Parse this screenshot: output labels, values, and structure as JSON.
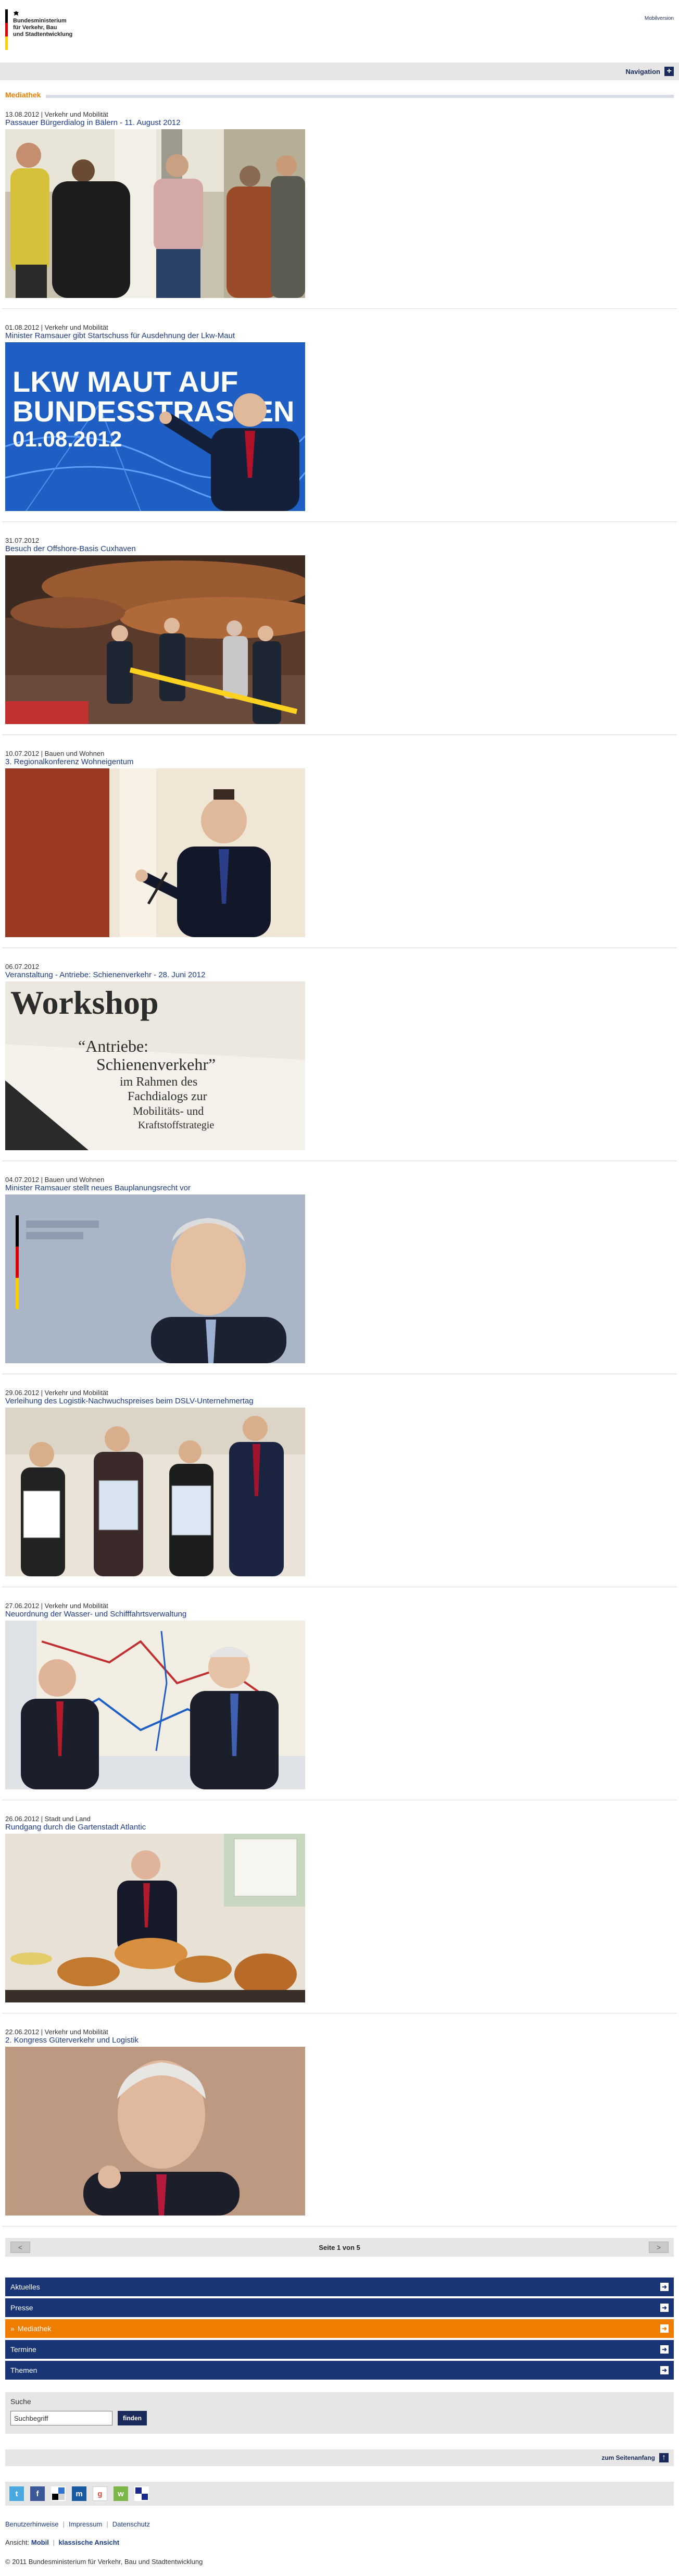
{
  "header": {
    "logo_lines": [
      "Bundesministerium",
      "für Verkehr, Bau",
      "und Stadtentwicklung"
    ],
    "mobile_version": "Mobilversion"
  },
  "navbar": {
    "label": "Navigation"
  },
  "section": {
    "title": "Mediathek"
  },
  "items": [
    {
      "meta": "13.08.2012 | Verkehr und Mobilität",
      "title": "Passauer Bürgerdialog in Bälern - 11. August 2012"
    },
    {
      "meta": "01.08.2012 | Verkehr und Mobilität",
      "title": "Minister Ramsauer gibt Startschuss für Ausdehnung der Lkw-Maut",
      "overlay1": "LKW MAUT AUF",
      "overlay2": "BUNDESSTRASSEN",
      "overlay3": "01.08.2012"
    },
    {
      "meta": "31.07.2012",
      "title": "Besuch der Offshore-Basis Cuxhaven"
    },
    {
      "meta": "10.07.2012 | Bauen und Wohnen",
      "title": "3. Regionalkonferenz Wohneigentum"
    },
    {
      "meta": "06.07.2012",
      "title": "Veranstaltung - Antriebe: Schienenverkehr - 28. Juni 2012",
      "overlay1": "Workshop",
      "overlay2": "“Antriebe:",
      "overlay3": "Schienenverkehr”",
      "overlay4": "im Rahmen des",
      "overlay5": "Fachdialogs zur",
      "overlay6": "Mobilitäts- und",
      "overlay7": "Kraftstoffstrategie"
    },
    {
      "meta": "04.07.2012 | Bauen und Wohnen",
      "title": "Minister Ramsauer stellt neues Bauplanungsrecht vor"
    },
    {
      "meta": "29.06.2012 | Verkehr und Mobilität",
      "title": "Verleihung des Logistik-Nachwuchspreises beim DSLV-Unternehmertag"
    },
    {
      "meta": "27.06.2012 | Verkehr und Mobilität",
      "title": "Neuordnung der Wasser- und Schifffahrtsverwaltung"
    },
    {
      "meta": "26.06.2012 | Stadt und Land",
      "title": "Rundgang durch die Gartenstadt Atlantic"
    },
    {
      "meta": "22.06.2012 | Verkehr und Mobilität",
      "title": "2. Kongress Güterverkehr und Logistik"
    }
  ],
  "pager": {
    "prev": "<",
    "text": "Seite 1 von 5",
    "next": ">"
  },
  "footer_nav": [
    {
      "label": "Aktuelles",
      "active": false
    },
    {
      "label": "Presse",
      "active": false
    },
    {
      "label": "Mediathek",
      "active": true
    },
    {
      "label": "Termine",
      "active": false
    },
    {
      "label": "Themen",
      "active": false
    }
  ],
  "search": {
    "label": "Suche",
    "placeholder": "Suchbegriff",
    "button": "finden"
  },
  "totop": {
    "label": "zum Seitenanfang"
  },
  "social_icons": [
    "twitter-icon",
    "facebook-icon",
    "delicious-icon",
    "myspace-icon",
    "google-icon",
    "mister-wong-icon",
    "share-icon"
  ],
  "links": [
    "Benutzerhinweise",
    "Impressum",
    "Datenschutz"
  ],
  "view": {
    "prefix": "Ansicht:",
    "mobile": "Mobil",
    "classic": "klassische Ansicht"
  },
  "copyright": "© 2011 Bundesministerium für Verkehr, Bau und Stadtentwicklung",
  "colors": {
    "navy": "#1a2a5b",
    "orange": "#ef7d00",
    "link": "#1a3a8a",
    "footer_nav": "#1a3575"
  }
}
